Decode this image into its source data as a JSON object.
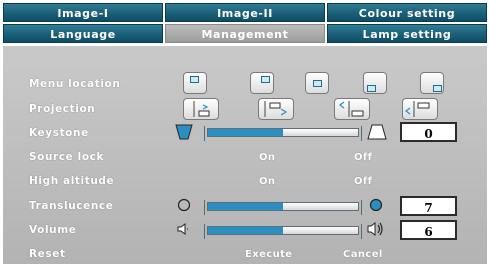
{
  "tabs_row1": [
    "Image-I",
    "Image-II",
    "Colour setting"
  ],
  "tabs_row2": [
    "Language",
    "Management",
    "Lamp setting"
  ],
  "active_tab": "Management",
  "labels": {
    "menu_location": "Menu location",
    "projection": "Projection",
    "keystone": "Keystone",
    "source_lock": "Source lock",
    "high_altitude": "High altitude",
    "translucence": "Translucence",
    "volume": "Volume",
    "reset": "Reset"
  },
  "source_lock": {
    "on": "On",
    "off": "Off"
  },
  "high_altitude": {
    "on": "On",
    "off": "Off"
  },
  "keystone": {
    "value": "0",
    "level": 0.5
  },
  "translucence": {
    "value": "7",
    "level": 0.5
  },
  "volume": {
    "value": "6",
    "level": 0.5
  },
  "reset": {
    "execute": "Execute",
    "cancel": "Cancel"
  },
  "menu_location_options": [
    "top-left",
    "top-right",
    "center",
    "bottom-left",
    "bottom-right"
  ],
  "projection_options": [
    "front-desk",
    "rear-desk",
    "front-ceiling",
    "rear-ceiling"
  ],
  "colors": {
    "accent": "#2d8fc1",
    "tab": "#1b5f78",
    "panel": "#bdbdbd"
  },
  "icons": {
    "keystone_left": "trapezoid-narrow-top-icon",
    "keystone_right": "trapezoid-wide-bottom-icon",
    "translucence_left": "circle-empty-icon",
    "translucence_right": "circle-filled-icon",
    "volume_left": "speaker-low-icon",
    "volume_right": "speaker-high-icon"
  }
}
